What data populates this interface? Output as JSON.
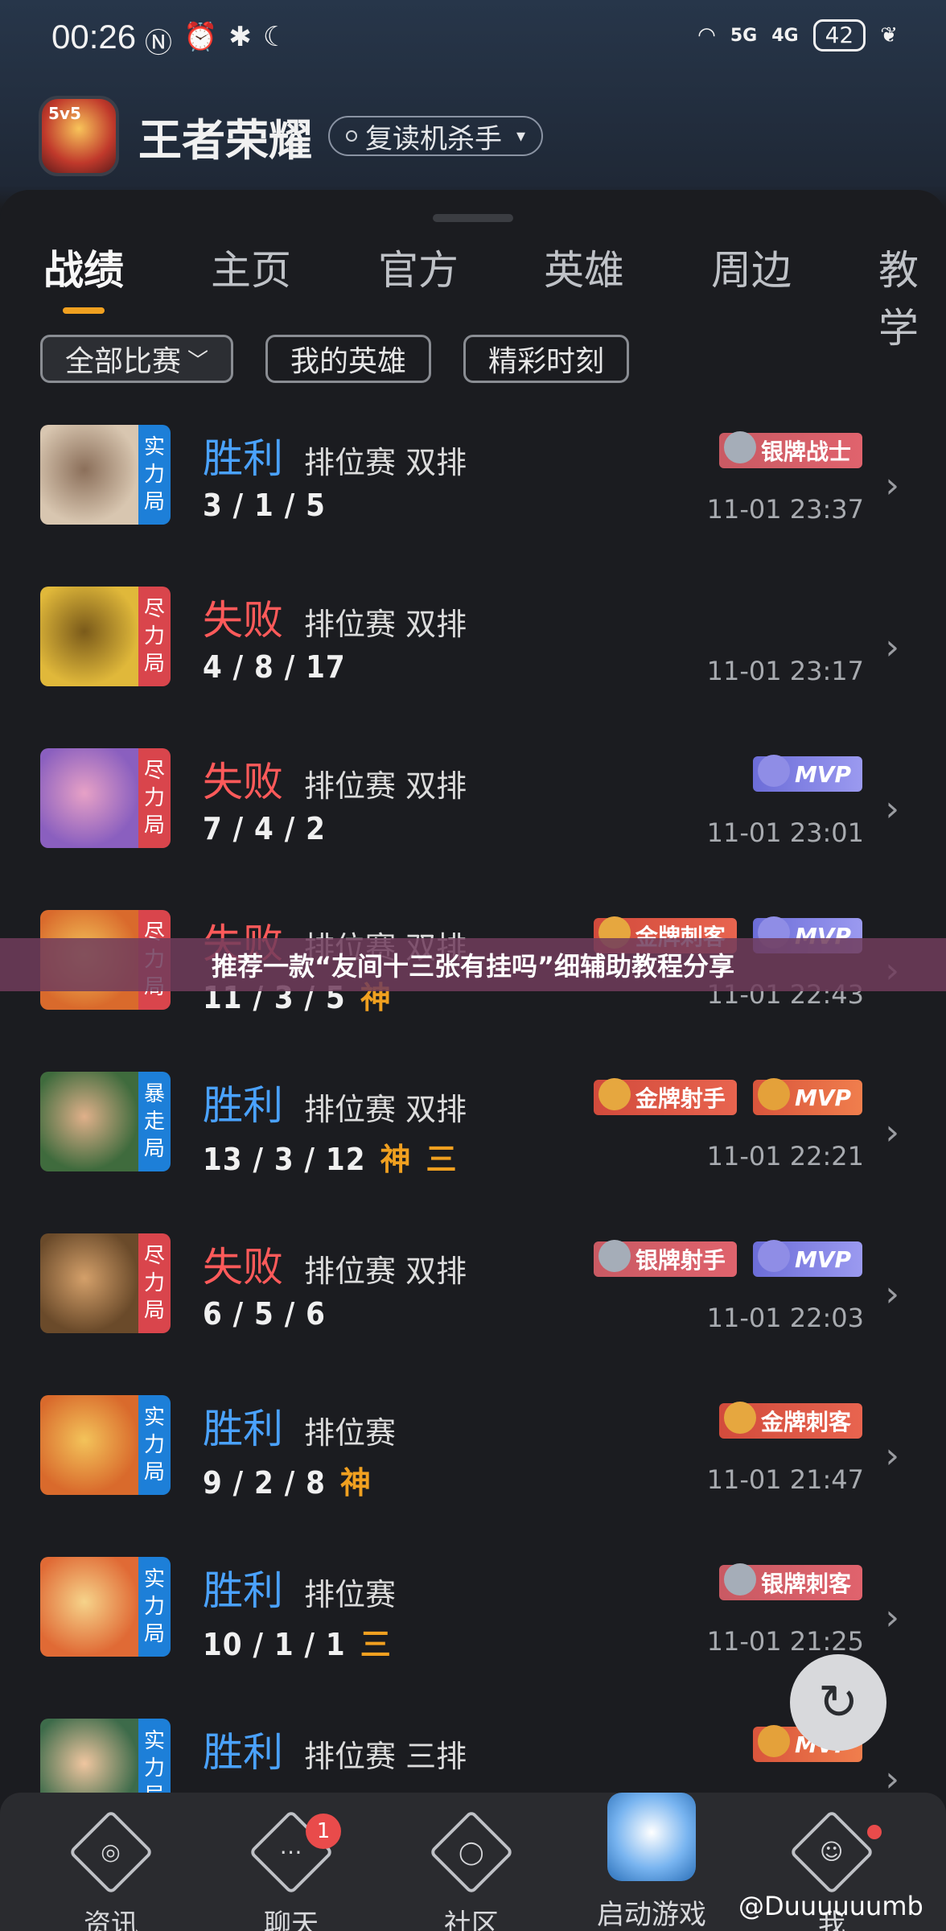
{
  "status": {
    "time": "00:26",
    "battery": "42",
    "sig1": "5G",
    "sig2": "4G"
  },
  "header": {
    "app_title": "王者荣耀",
    "server": "复读机杀手"
  },
  "tabs": [
    "战绩",
    "主页",
    "官方",
    "英雄",
    "周边",
    "教学"
  ],
  "filters": [
    "全部比赛",
    "我的英雄",
    "精彩时刻"
  ],
  "matches": [
    {
      "tag": [
        "实",
        "力",
        "局"
      ],
      "result": "胜利",
      "mode": "排位赛 双排",
      "kda": "3 / 1 / 5",
      "god": "",
      "triple": "",
      "time": "11-01 23:37",
      "badges": [
        {
          "type": "silver",
          "label": "银牌战士"
        }
      ]
    },
    {
      "tag": [
        "尽",
        "力",
        "局"
      ],
      "result": "失败",
      "mode": "排位赛 双排",
      "kda": "4 / 8 / 17",
      "god": "",
      "triple": "",
      "time": "11-01 23:17",
      "badges": []
    },
    {
      "tag": [
        "尽",
        "力",
        "局"
      ],
      "result": "失败",
      "mode": "排位赛 双排",
      "kda": "7 / 4 / 2",
      "god": "",
      "triple": "",
      "time": "11-01 23:01",
      "badges": [
        {
          "type": "mvp-purple",
          "label": "MVP"
        }
      ]
    },
    {
      "tag": [
        "尽",
        "力",
        "局"
      ],
      "result": "失败",
      "mode": "排位赛 双排",
      "kda": "11 / 3 / 5",
      "god": "神",
      "triple": "",
      "time": "11-01 22:43",
      "badges": [
        {
          "type": "gold",
          "label": "金牌刺客"
        },
        {
          "type": "mvp-purple",
          "label": "MVP"
        }
      ]
    },
    {
      "tag": [
        "暴",
        "走",
        "局"
      ],
      "result": "胜利",
      "mode": "排位赛 双排",
      "kda": "13 / 3 / 12",
      "god": "神",
      "triple": "三",
      "time": "11-01 22:21",
      "badges": [
        {
          "type": "gold",
          "label": "金牌射手"
        },
        {
          "type": "mvp-gold",
          "label": "MVP"
        }
      ]
    },
    {
      "tag": [
        "尽",
        "力",
        "局"
      ],
      "result": "失败",
      "mode": "排位赛 双排",
      "kda": "6 / 5 / 6",
      "god": "",
      "triple": "",
      "time": "11-01 22:03",
      "badges": [
        {
          "type": "silver",
          "label": "银牌射手"
        },
        {
          "type": "mvp-purple",
          "label": "MVP"
        }
      ]
    },
    {
      "tag": [
        "实",
        "力",
        "局"
      ],
      "result": "胜利",
      "mode": "排位赛",
      "kda": "9 / 2 / 8",
      "god": "神",
      "triple": "",
      "time": "11-01 21:47",
      "badges": [
        {
          "type": "gold",
          "label": "金牌刺客"
        }
      ]
    },
    {
      "tag": [
        "实",
        "力",
        "局"
      ],
      "result": "胜利",
      "mode": "排位赛",
      "kda": "10 / 1 / 1",
      "god": "",
      "triple": "三",
      "time": "11-01 21:25",
      "badges": [
        {
          "type": "silver",
          "label": "银牌刺客"
        }
      ]
    },
    {
      "tag": [
        "实",
        "力",
        "局"
      ],
      "result": "胜利",
      "mode": "排位赛 三排",
      "kda": "",
      "god": "",
      "triple": "",
      "time": "",
      "badges": [
        {
          "type": "mvp-gold",
          "label": "MVP"
        }
      ]
    }
  ],
  "banner": "推荐一款“友间十三张有挂吗”细辅助教程分享",
  "nav": [
    {
      "label": "资讯",
      "icon": "news-icon"
    },
    {
      "label": "聊天",
      "icon": "chat-icon",
      "badge": "1"
    },
    {
      "label": "社区",
      "icon": "community-icon"
    },
    {
      "label": "启动游戏",
      "icon": "launch-game-icon"
    },
    {
      "label": "我",
      "icon": "profile-icon"
    }
  ],
  "watermark": "@Duuuuuumb"
}
